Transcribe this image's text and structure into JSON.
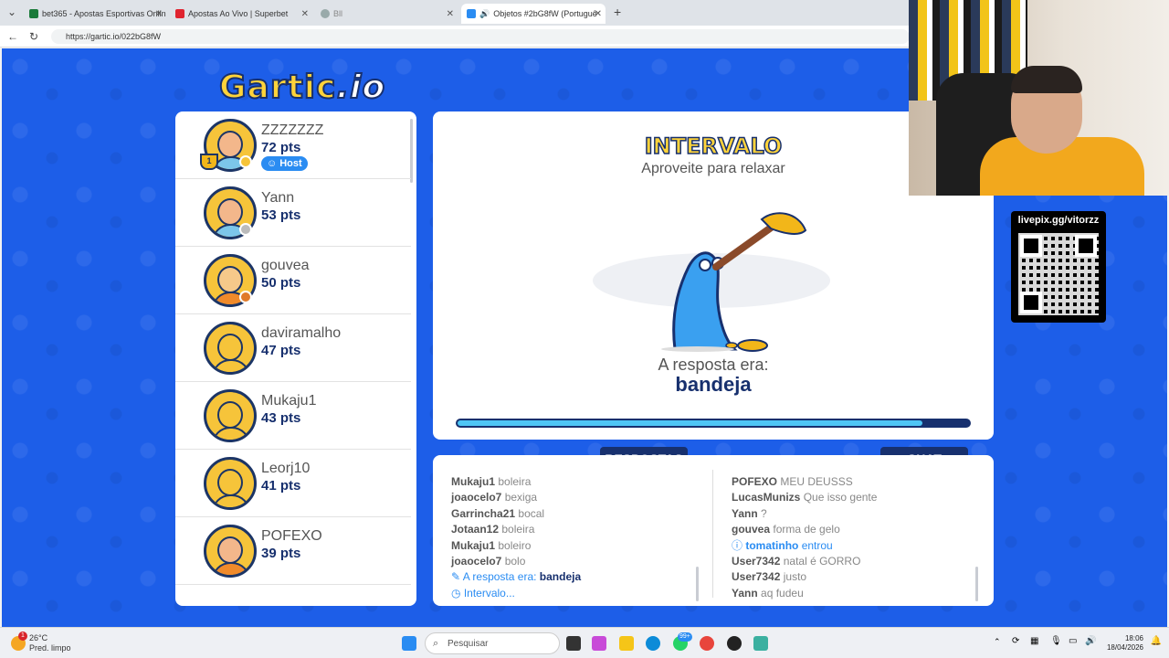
{
  "browser": {
    "tabs": [
      {
        "label": "bet365 - Apostas Esportivas Online",
        "favicon_color": "#1a7a3a"
      },
      {
        "label": "Apostas Ao Vivo | Superbet",
        "favicon_color": "#e0242f"
      },
      {
        "label": "Bll",
        "favicon_color": "#9aa"
      },
      {
        "label": "Objetos #2bG8fW (Portuguê",
        "favicon_color": "#2a8cf2"
      }
    ],
    "url": "https://gartic.io/022bG8fW"
  },
  "logo": {
    "main": "Gartic",
    "suffix": ".io"
  },
  "players": [
    {
      "name": "ZZZZZZZ",
      "pts": "72 pts",
      "status_color": "#f6c43a",
      "host": true,
      "rank": "1",
      "skin": "#f3b78b",
      "shirt": "#7cc6ea"
    },
    {
      "name": "Yann",
      "pts": "53 pts",
      "status_color": "#bbbbbb",
      "host": false,
      "skin": "#f3b78b",
      "shirt": "#7cc6ea"
    },
    {
      "name": "gouvea",
      "pts": "50 pts",
      "status_color": "#e07a2a",
      "host": false,
      "skin": "#f6c98a",
      "shirt": "#f08a2a"
    },
    {
      "name": "daviramalho",
      "pts": "47 pts",
      "status_color": null,
      "host": false,
      "skin": "#f6c43a",
      "shirt": "#f6c43a"
    },
    {
      "name": "Mukaju1",
      "pts": "43 pts",
      "status_color": null,
      "host": false,
      "skin": "#f6c43a",
      "shirt": "#f6c43a"
    },
    {
      "name": "Leorj10",
      "pts": "41 pts",
      "status_color": null,
      "host": false,
      "skin": "#f6c43a",
      "shirt": "#f6c43a"
    },
    {
      "name": "POFEXO",
      "pts": "39 pts",
      "status_color": null,
      "host": false,
      "skin": "#f3b78b",
      "shirt": "#f08a2a"
    }
  ],
  "host_label": "Host",
  "stage": {
    "title": "INTERVALO",
    "subtitle": "Aproveite para relaxar",
    "answer_label": "A resposta era:",
    "answer_word": "bandeja",
    "progress": 0.915
  },
  "tabs": {
    "answers": "RESPOSTAS",
    "chat": "CHAT"
  },
  "answers": [
    {
      "user": "Mukaju1",
      "text": "boleira"
    },
    {
      "user": "joaocelo7",
      "text": "bexiga"
    },
    {
      "user": "Garrincha21",
      "text": "bocal"
    },
    {
      "user": "Jotaan12",
      "text": "boleira"
    },
    {
      "user": "Mukaju1",
      "text": "boleiro"
    },
    {
      "user": "joaocelo7",
      "text": "bolo"
    }
  ],
  "answers_system": [
    {
      "icon": "pencil-icon",
      "text": "A resposta era: ",
      "bold": "bandeja"
    },
    {
      "icon": "clock-icon",
      "text": "Intervalo...",
      "bold": ""
    }
  ],
  "chat": [
    {
      "user": "POFEXO",
      "text": "MEU DEUSSS"
    },
    {
      "user": "LucasMunizs",
      "text": "Que isso gente"
    },
    {
      "user": "Yann",
      "text": "?"
    },
    {
      "user": "gouvea",
      "text": "forma de gelo"
    },
    {
      "user": "tomatinho",
      "text": "entrou",
      "system": true
    },
    {
      "user": "User7342",
      "text": "natal é GORRO"
    },
    {
      "user": "User7342",
      "text": "justo"
    },
    {
      "user": "Yann",
      "text": "aq fudeu"
    }
  ],
  "qr": {
    "label": "livepix.gg/vitorzz"
  },
  "taskbar": {
    "temp": "26°C",
    "weather": "Pred. limpo",
    "search_placeholder": "Pesquisar",
    "badge": "99+",
    "time": "18:06",
    "date": "18/04/2026",
    "notif": "1"
  }
}
